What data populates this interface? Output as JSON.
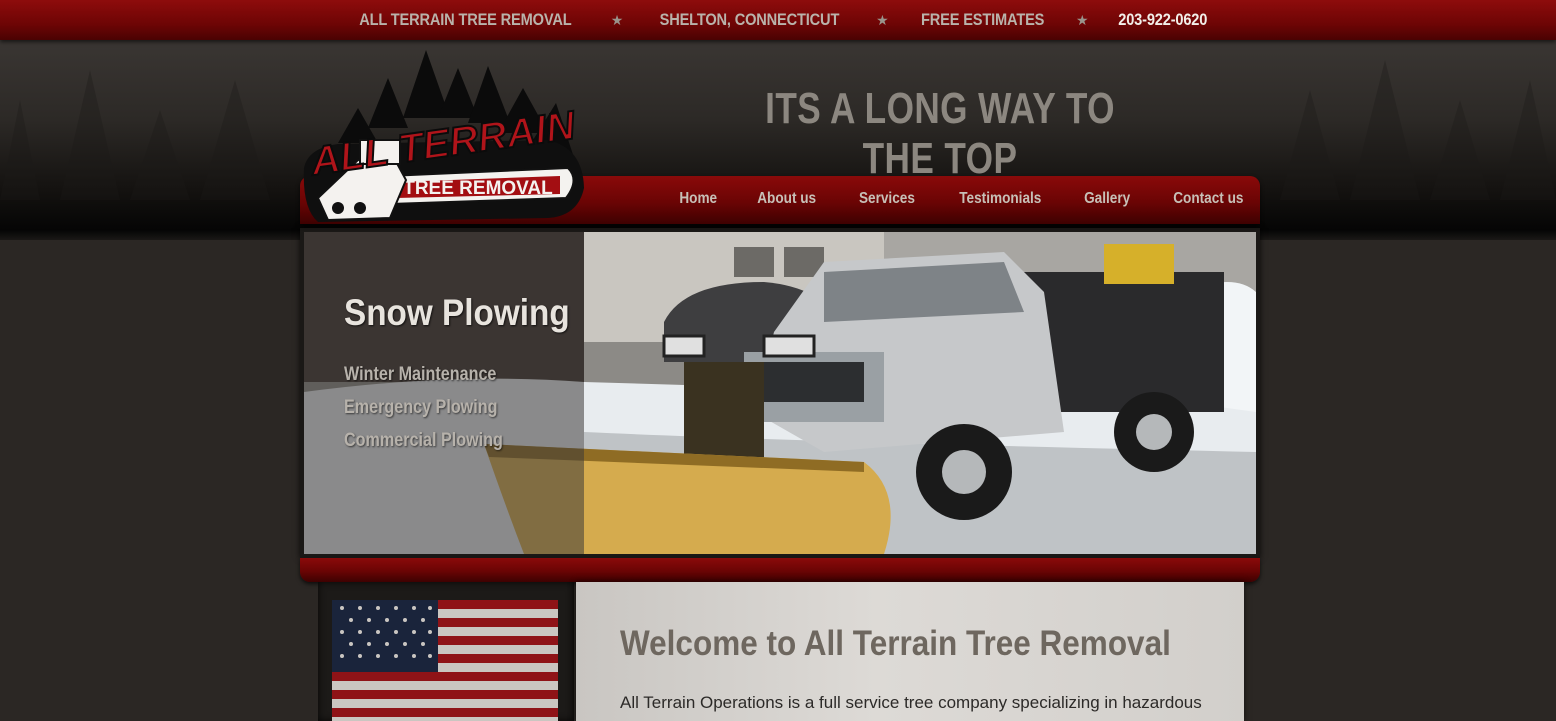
{
  "topbar": {
    "company": "ALL TERRAIN TREE REMOVAL",
    "location": "SHELTON, CONNECTICUT",
    "offer": "FREE ESTIMATES",
    "phone": "203-922-0620",
    "separator_icon": "star-icon"
  },
  "logo": {
    "line1": "ALL TERRAIN",
    "line2": "TREE REMOVAL"
  },
  "slogan": "ITS A LONG WAY TO THE TOP",
  "nav": {
    "items": [
      {
        "label": "Home"
      },
      {
        "label": "About us"
      },
      {
        "label": "Services"
      },
      {
        "label": "Testimonials"
      },
      {
        "label": "Gallery"
      },
      {
        "label": "Contact us"
      }
    ]
  },
  "slide": {
    "title": "Snow Plowing",
    "items": [
      "Winter Maintenance",
      "Emergency Plowing",
      "Commercial Plowing"
    ]
  },
  "content": {
    "heading": "Welcome to All Terrain Tree Removal",
    "intro": "All Terrain Operations is a full service tree company specializing in hazardous"
  },
  "colors": {
    "brand_red": "#7a0606",
    "background": "#2a2623",
    "text_muted": "#b9b3ab"
  }
}
